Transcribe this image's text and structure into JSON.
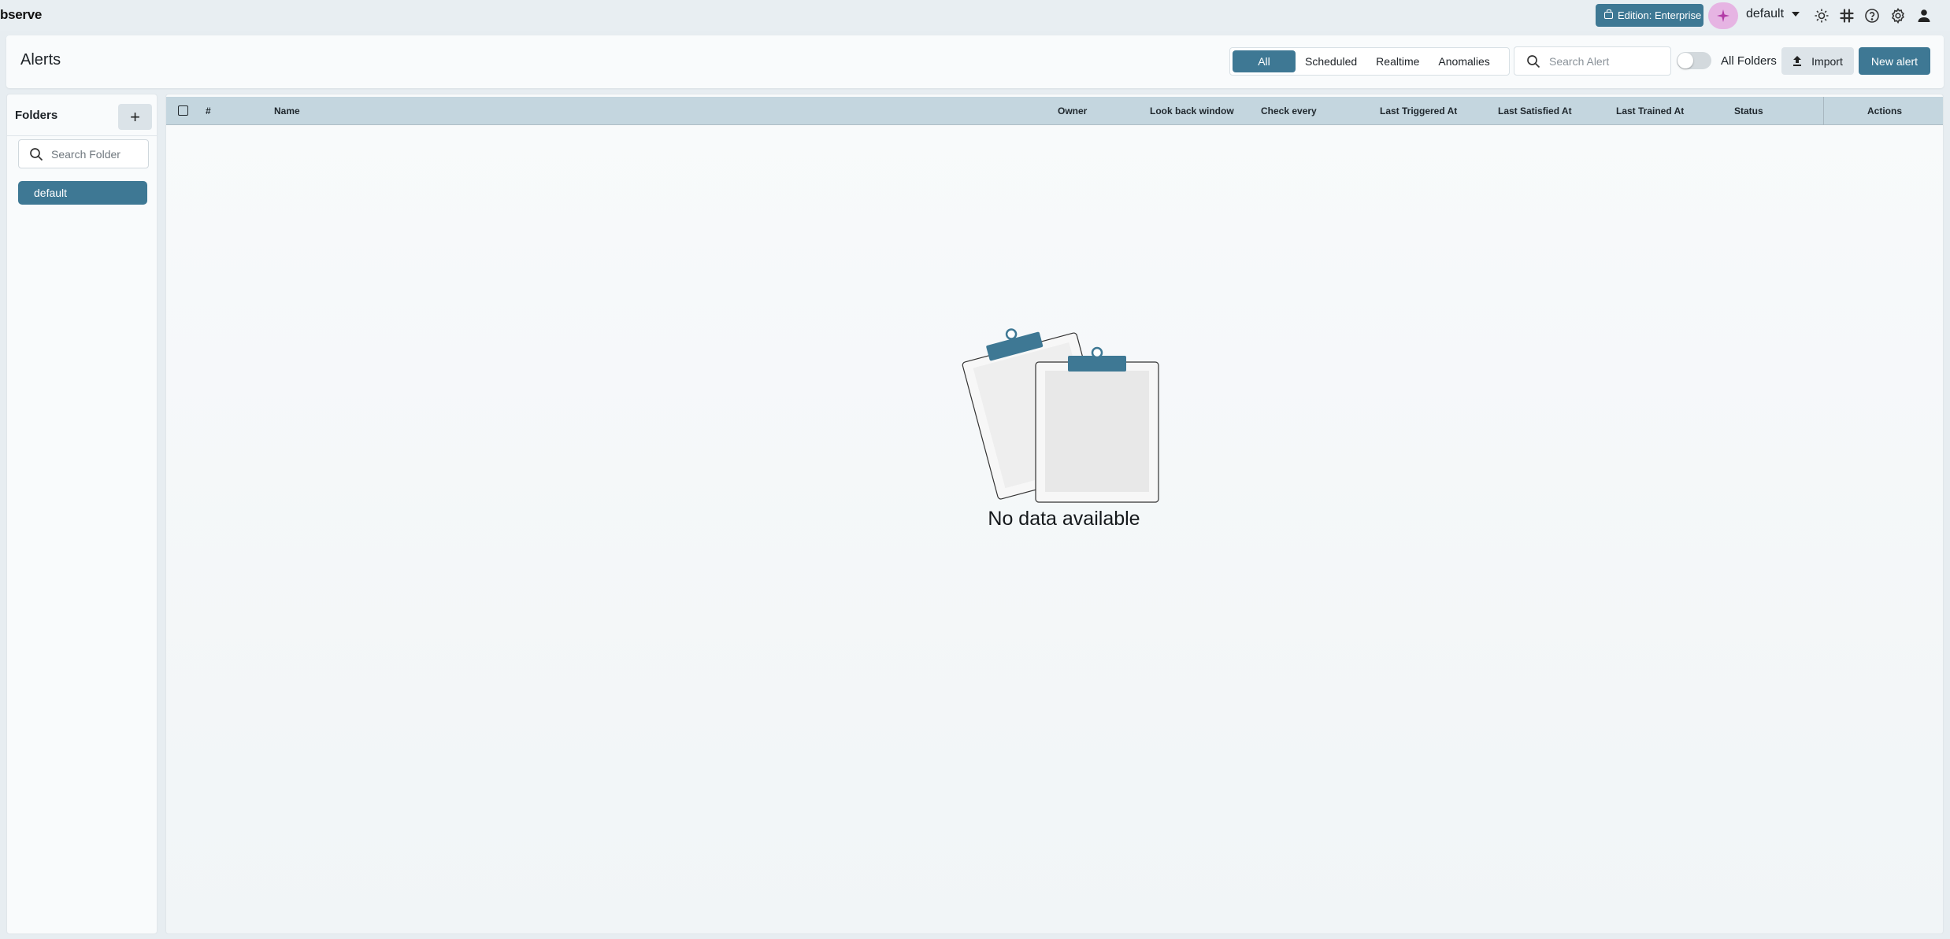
{
  "topbar": {
    "brand": "bserve",
    "edition_label": "Edition: Enterprise",
    "org_name": "default",
    "icons": [
      "sun-icon",
      "slack-icon",
      "help-icon",
      "settings-icon",
      "user-icon"
    ]
  },
  "header": {
    "title": "Alerts",
    "tabs": [
      {
        "label": "All",
        "active": true
      },
      {
        "label": "Scheduled",
        "active": false
      },
      {
        "label": "Realtime",
        "active": false
      },
      {
        "label": "Anomalies",
        "active": false
      }
    ],
    "search_placeholder": "Search Alert",
    "toggle_label": "All Folders",
    "toggle_on": false,
    "import_label": "Import",
    "new_alert_label": "New alert"
  },
  "sidebar": {
    "title": "Folders",
    "add_label": "+",
    "search_placeholder": "Search Folder",
    "items": [
      {
        "label": "default",
        "selected": true
      }
    ]
  },
  "table": {
    "columns": [
      "#",
      "Name",
      "Owner",
      "Look back window",
      "Check every",
      "Last Triggered At",
      "Last Satisfied At",
      "Last Trained At",
      "Status",
      "Actions"
    ],
    "rows": [],
    "empty_text": "No data available"
  },
  "colors": {
    "accent": "#3e7894",
    "table_header": "#c4d6df",
    "ai_button": "#e6b4e3"
  }
}
